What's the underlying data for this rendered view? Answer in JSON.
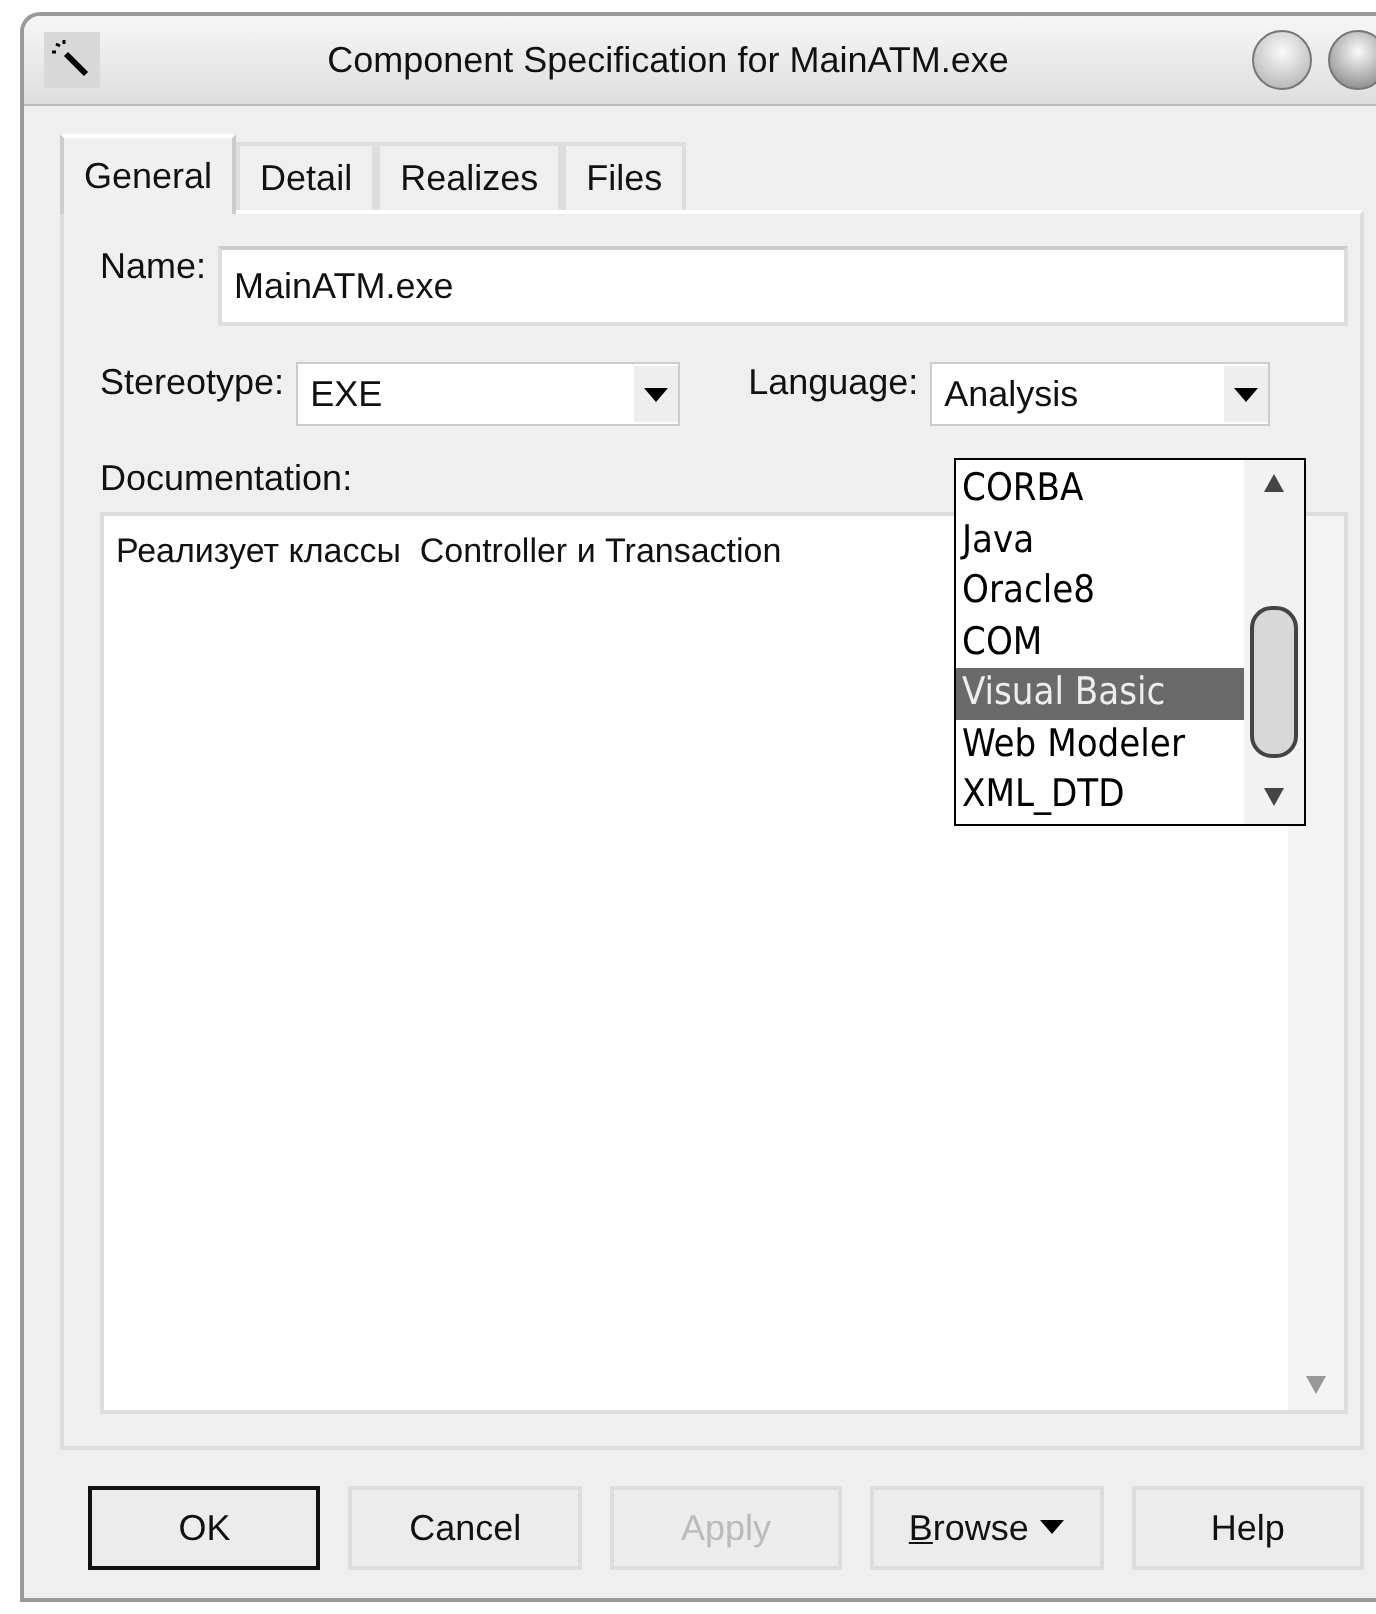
{
  "window": {
    "title": "Component Specification for MainATM.exe"
  },
  "tabs": [
    {
      "label": "General",
      "selected": true
    },
    {
      "label": "Detail",
      "selected": false
    },
    {
      "label": "Realizes",
      "selected": false
    },
    {
      "label": "Files",
      "selected": false
    }
  ],
  "name": {
    "label": "Name:",
    "value": "MainATM.exe"
  },
  "stereotype": {
    "label": "Stereotype:",
    "value": "EXE"
  },
  "language": {
    "label": "Language:",
    "value": "Analysis",
    "expanded": true,
    "options": [
      {
        "label": "CORBA",
        "selected": false
      },
      {
        "label": "Java",
        "selected": false
      },
      {
        "label": "Oracle8",
        "selected": false
      },
      {
        "label": "COM",
        "selected": false
      },
      {
        "label": "Visual Basic",
        "selected": true
      },
      {
        "label": "Web Modeler",
        "selected": false
      },
      {
        "label": "XML_DTD",
        "selected": false
      }
    ]
  },
  "documentation": {
    "label": "Documentation:",
    "value": "Реализует классы  Controller и Transaction"
  },
  "buttons": [
    {
      "label": "OK",
      "default": true,
      "disabled": false,
      "kind": "plain"
    },
    {
      "label": "Cancel",
      "default": false,
      "disabled": false,
      "kind": "plain"
    },
    {
      "label": "Apply",
      "default": false,
      "disabled": true,
      "kind": "plain"
    },
    {
      "label": "Browse",
      "default": false,
      "disabled": false,
      "kind": "menu"
    },
    {
      "label": "Help",
      "default": false,
      "disabled": false,
      "kind": "plain"
    }
  ]
}
